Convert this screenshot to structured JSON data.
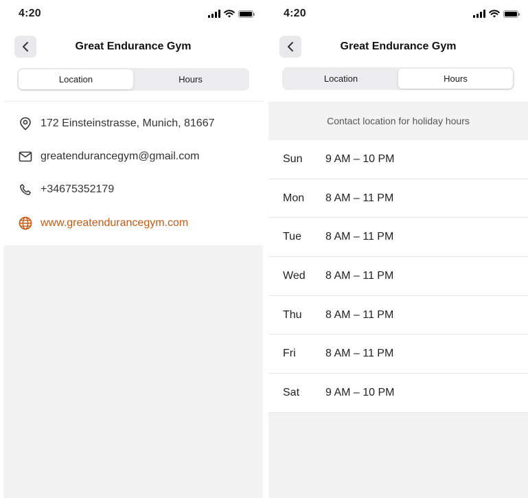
{
  "left_screen": {
    "status": {
      "time": "4:20"
    },
    "header": {
      "title": "Great Endurance Gym"
    },
    "tabs": [
      {
        "label": "Location",
        "selected": true
      },
      {
        "label": "Hours",
        "selected": false
      }
    ],
    "location": {
      "address": "172  Einsteinstrasse, Munich,  81667",
      "email": "greatendurancegym@gmail.com",
      "phone": "+34675352179",
      "website": "www.greatendurancegym.com"
    }
  },
  "right_screen": {
    "status": {
      "time": "4:20"
    },
    "header": {
      "title": "Great Endurance Gym"
    },
    "tabs": [
      {
        "label": "Location",
        "selected": false
      },
      {
        "label": "Hours",
        "selected": true
      }
    ],
    "hours": {
      "holiday_note": "Contact location for holiday hours",
      "days": [
        {
          "day": "Sun",
          "time": "9 AM – 10 PM"
        },
        {
          "day": "Mon",
          "time": "8 AM – 11 PM"
        },
        {
          "day": "Tue",
          "time": "8 AM – 11 PM"
        },
        {
          "day": "Wed",
          "time": "8 AM – 11 PM"
        },
        {
          "day": "Thu",
          "time": "8 AM – 11 PM"
        },
        {
          "day": "Fri",
          "time": "8 AM – 11 PM"
        },
        {
          "day": "Sat",
          "time": "9 AM – 10 PM"
        }
      ]
    }
  },
  "colors": {
    "accent": "#c85a12",
    "background_gray": "#f3f3f3",
    "segment_track": "#ececee"
  },
  "icons": [
    "back-chevron-icon",
    "signal-icon",
    "wifi-icon",
    "battery-icon",
    "location-pin-icon",
    "mail-icon",
    "phone-icon",
    "globe-icon"
  ]
}
